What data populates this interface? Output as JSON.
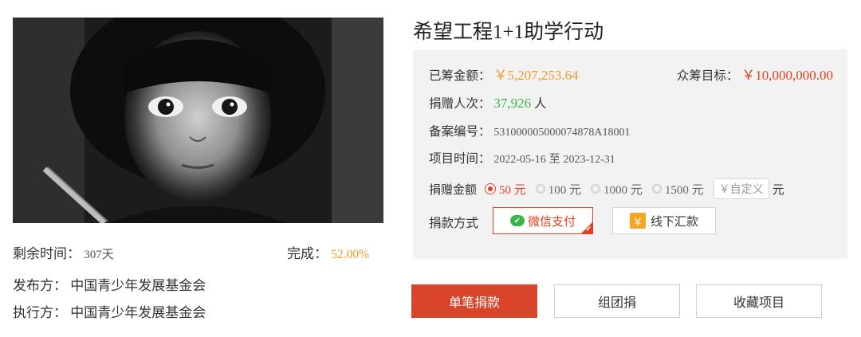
{
  "project": {
    "title": "希望工程1+1助学行动"
  },
  "left": {
    "remaining_label": "剩余时间：",
    "remaining_value": "307天",
    "complete_label": "完成：",
    "complete_value": "52.00%",
    "publisher_label": "发布方：",
    "publisher_value": "中国青少年发展基金会",
    "executor_label": "执行方：",
    "executor_value": "中国青少年发展基金会"
  },
  "panel": {
    "raised_label": "已筹金额：",
    "raised_value": "￥5,207,253.64",
    "goal_label": "众筹目标：",
    "goal_value": "￥10,000,000.00",
    "donors_label": "捐赠人次：",
    "donors_value": "37,926",
    "donors_unit": "人",
    "record_label": "备案编号：",
    "record_value": "531000005000074878A18001",
    "time_label": "项目时间：",
    "time_start": "2022-05-16",
    "time_sep": "至",
    "time_end": "2023-12-31",
    "amount_label": "捐赠金额",
    "amount_options": [
      "50 元",
      "100 元",
      "1000 元",
      "1500 元"
    ],
    "amount_selected": "50 元",
    "custom_placeholder": "￥自定义",
    "custom_unit": "元",
    "pay_label": "捐款方式",
    "pay_wechat": "微信支付",
    "pay_offline": "线下汇款"
  },
  "actions": {
    "donate": "单笔捐款",
    "group": "组团捐",
    "favorite": "收藏项目"
  },
  "colors": {
    "accent_red": "#d9452a",
    "orange": "#f39a2b",
    "green": "#3bb54a"
  }
}
